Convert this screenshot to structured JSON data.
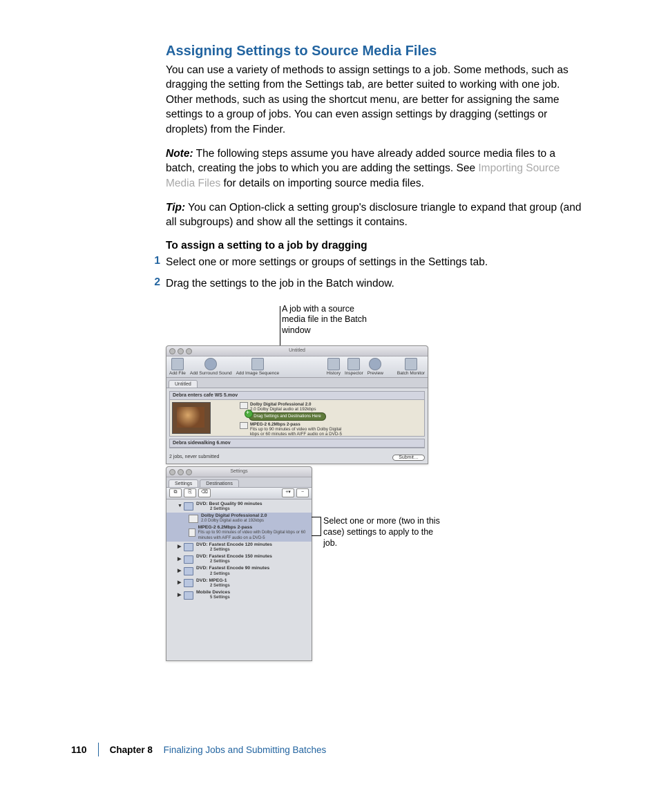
{
  "heading": "Assigning Settings to Source Media Files",
  "intro": "You can use a variety of methods to assign settings to a job. Some methods, such as dragging the setting from the Settings tab, are better suited to working with one job. Other methods, such as using the shortcut menu, are better for assigning the same settings to a group of jobs. You can even assign settings by dragging (settings or droplets) from the Finder.",
  "note_label": "Note:",
  "note_text_pre": "  The following steps assume you have already added source media files to a batch, creating the jobs to which you are adding the settings. See ",
  "note_link": "Importing Source Media Files",
  "note_text_post": " for details on importing source media files.",
  "tip_label": "Tip:",
  "tip_text": "  You can Option-click a setting group's disclosure triangle to expand that group (and all subgroups) and show all the settings it contains.",
  "subhead": "To assign a setting to a job by dragging",
  "steps": [
    {
      "n": "1",
      "t": "Select one or more settings or groups of settings in the Settings tab."
    },
    {
      "n": "2",
      "t": "Drag the settings to the job in the Batch window."
    }
  ],
  "callout_upper": "A job with a source media file in the Batch window",
  "callout_right": "Select one or more (two in this case) settings to apply to the job.",
  "batch": {
    "title": "Untitled",
    "tools": [
      "Add File",
      "Add Surround Sound",
      "Add Image Sequence",
      "History",
      "Inspector",
      "Preview",
      "Batch Monitor"
    ],
    "tab": "Untitled",
    "job1_name": "Debra enters cafe WS 5.mov",
    "drag_pill": "Drag Settings and Destinations Here",
    "drag_rows": [
      {
        "t1": "Dolby Digital Professional 2.0",
        "t2": "2.0 Dolby Digital audio at 192kbps"
      },
      {
        "t1": "MPEG-2 6.2Mbps 2-pass",
        "t2": "Fits up to 90 minutes of video with Dolby Digital"
      },
      {
        "t1": "",
        "t2": "kbps or 60 minutes with AIFF audio on a DVD-5"
      }
    ],
    "job2_name": "Debra sidewalking 6.mov",
    "status": "2 jobs, never submitted",
    "submit": "Submit…"
  },
  "settings": {
    "title": "Settings",
    "tabs": [
      "Settings",
      "Destinations"
    ],
    "groups": [
      {
        "open": true,
        "name": "DVD: Best Quality 90 minutes",
        "sub": "2 Settings",
        "children": [
          {
            "name": "Dolby Digital Professional 2.0",
            "sub": "2.0 Dolby Digital audio at 192kbps",
            "sel": true
          },
          {
            "name": "MPEG-2 6.2Mbps 2-pass",
            "sub": "Fits up to 90 minutes of video with Dolby Digital kbps or 60 minutes with AIFF audio on a DVD-5",
            "sel": true
          }
        ]
      },
      {
        "open": false,
        "name": "DVD: Fastest Encode 120 minutes",
        "sub": "2 Settings"
      },
      {
        "open": false,
        "name": "DVD: Fastest Encode 150 minutes",
        "sub": "2 Settings"
      },
      {
        "open": false,
        "name": "DVD: Fastest Encode 90 minutes",
        "sub": "2 Settings"
      },
      {
        "open": false,
        "name": "DVD: MPEG-1",
        "sub": "2 Settings"
      },
      {
        "open": false,
        "name": "Mobile Devices",
        "sub": "5 Settings"
      }
    ]
  },
  "footer": {
    "page": "110",
    "chapter_label": "Chapter 8",
    "chapter_title": "Finalizing Jobs and Submitting Batches"
  }
}
